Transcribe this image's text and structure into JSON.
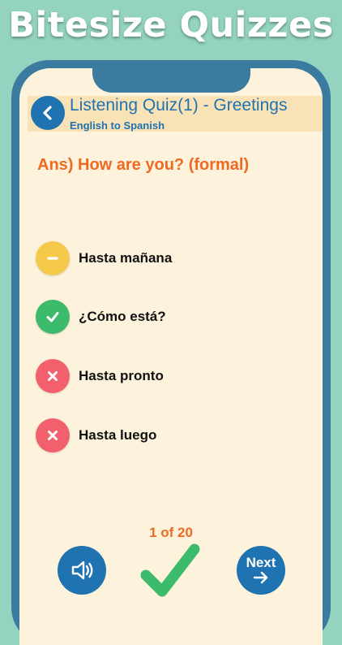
{
  "banner": {
    "title": "Bitesize Quizzes"
  },
  "header": {
    "title": "Listening Quiz(1) - Greetings",
    "subtitle": "English to Spanish",
    "back_icon": "chevron-left-icon"
  },
  "question": {
    "answer": "Ans) How are you? (formal)"
  },
  "options": [
    {
      "label": "Hasta mañana",
      "status": "neutral",
      "icon": "minus-icon",
      "color": "#f5c94a"
    },
    {
      "label": "¿Cómo está?",
      "status": "correct",
      "icon": "check-icon",
      "color": "#3dbb6d"
    },
    {
      "label": "Hasta pronto",
      "status": "wrong",
      "icon": "close-icon",
      "color": "#f2606e"
    },
    {
      "label": "Hasta luego",
      "status": "wrong",
      "icon": "close-icon",
      "color": "#f2606e"
    }
  ],
  "progress": {
    "text": "1 of 20",
    "current": 1,
    "total": 20
  },
  "footer": {
    "audio_icon": "speaker-icon",
    "result_icon": "check-icon",
    "next_label": "Next",
    "next_icon": "arrow-right-icon"
  },
  "colors": {
    "background": "#93d3c0",
    "phone_frame": "#3c7ba0",
    "screen": "#fdf3dc",
    "header_bar": "#f8e2b6",
    "primary_blue": "#1f73b0",
    "accent_orange": "#ee6a22",
    "correct_green": "#3dbb6d",
    "wrong_red": "#f2606e",
    "neutral_yellow": "#f5c94a"
  }
}
